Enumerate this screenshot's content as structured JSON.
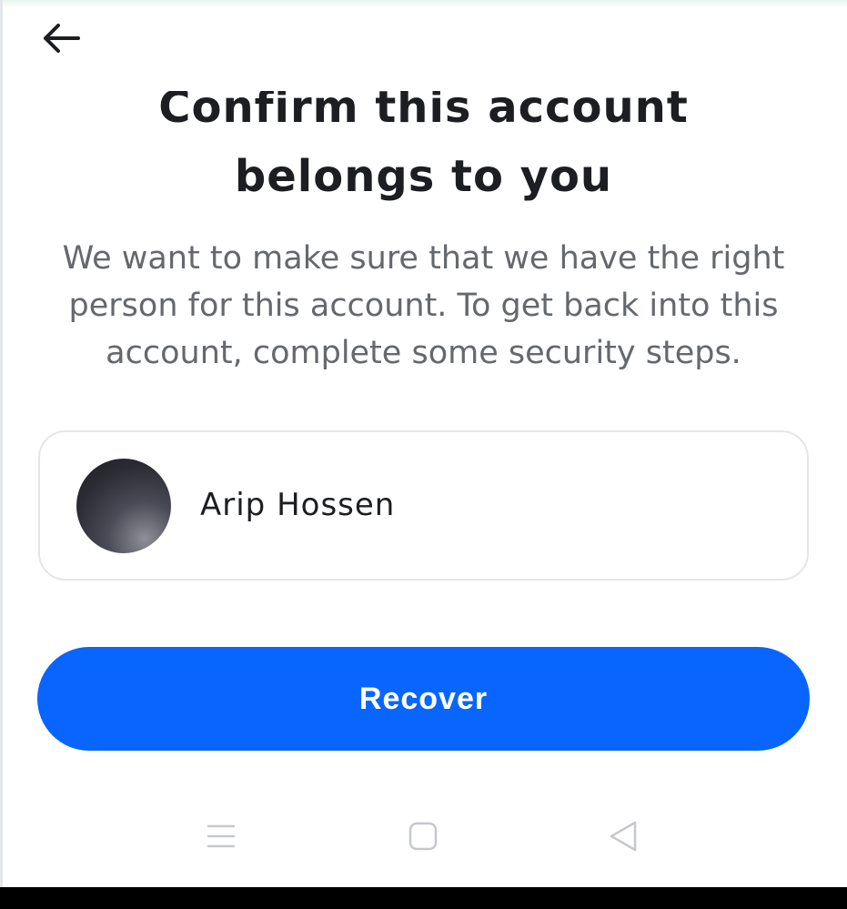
{
  "header": {
    "back_icon": "arrow-left-icon"
  },
  "title": {
    "line1": "Confirm this account",
    "line2": "belongs to you"
  },
  "description": "We want to make sure that we have the right person for this account. To get back into this account, complete some security steps.",
  "account": {
    "name": "Arip Hossen",
    "avatar_icon": "profile-photo"
  },
  "actions": {
    "recover_label": "Recover"
  },
  "nav_bar": {
    "menu_icon": "recent-apps-icon",
    "home_icon": "home-icon",
    "back_icon": "back-triangle-icon"
  },
  "colors": {
    "primary": "#0866ff",
    "title_text": "#1c1e21",
    "secondary_text": "#65686c",
    "card_border": "#e3e6ea"
  }
}
